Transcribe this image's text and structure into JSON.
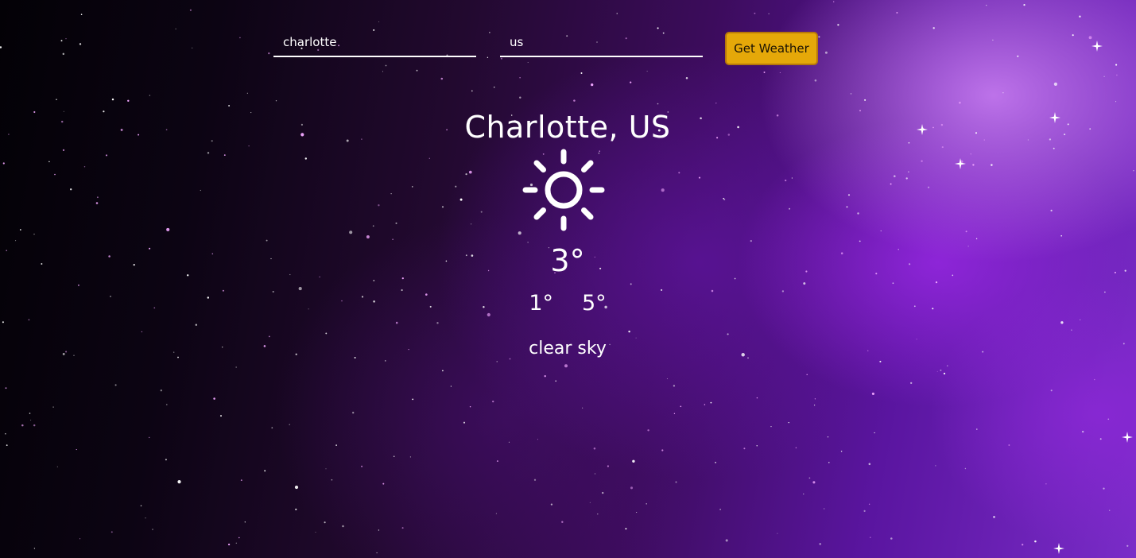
{
  "search": {
    "city_value": "charlotte",
    "country_value": "us",
    "button_label": "Get Weather"
  },
  "weather": {
    "location": "Charlotte, US",
    "icon": "sun-icon",
    "temperature": "3°",
    "temp_min": "1°",
    "temp_max": "5°",
    "description": "clear sky"
  },
  "colors": {
    "button": "#e5a809",
    "text": "#ffffff",
    "background_accent": "#7a2cc8"
  }
}
